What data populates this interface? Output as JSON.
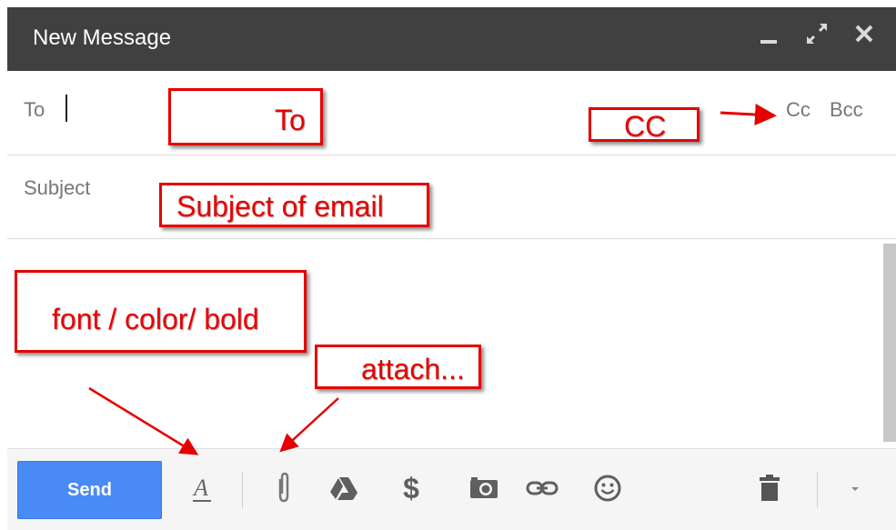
{
  "window": {
    "title": "New Message",
    "controls": [
      "minimize-icon",
      "expand-icon",
      "close-icon"
    ]
  },
  "to_field": {
    "label": "To",
    "value": ""
  },
  "cc_links": {
    "cc": "Cc",
    "bcc": "Bcc"
  },
  "subject_field": {
    "label": "Subject",
    "value": ""
  },
  "body": {
    "value": ""
  },
  "toolbar": {
    "send_label": "Send",
    "icons": [
      "formatting-icon",
      "attach-icon",
      "drive-icon",
      "money-icon",
      "photo-icon",
      "link-icon",
      "emoji-icon",
      "trash-icon",
      "more-options-icon"
    ]
  },
  "annotations": {
    "to": "To",
    "cc": "CC",
    "subject": "Subject of email",
    "font": "font / color/ bold",
    "attach": "attach..."
  },
  "colors": {
    "titlebar": "#404040",
    "send_button": "#4a8af4",
    "annotation": "#e60000",
    "toolbar_bg": "#f5f5f5"
  }
}
